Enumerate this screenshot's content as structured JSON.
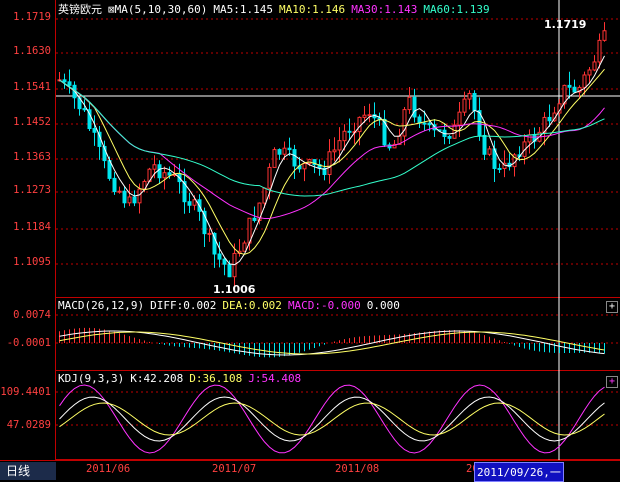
{
  "tab_label": "日线",
  "main": {
    "symbol": "英镑欧元",
    "ma_title": "MA(5,10,30,60)",
    "ma5": "MA5:1.145",
    "ma10": "MA10:1.146",
    "ma30": "MA30:1.143",
    "ma60": "MA60:1.139",
    "high_label": "1.1719",
    "low_label": "1.1006",
    "y_ticks": [
      "1.1719",
      "1.1630",
      "1.1541",
      "1.1452",
      "1.1363",
      "1.1273",
      "1.1184",
      "1.1095"
    ]
  },
  "macd": {
    "title": "MACD(26,12,9)",
    "diff": "DIFF:0.002",
    "dea": "DEA:0.002",
    "macd": "MACD:-0.000",
    "extra": "0.000",
    "y_ticks": [
      "0.0074",
      "-0.0001"
    ]
  },
  "kdj": {
    "title": "KDJ(9,3,3)",
    "k": "K:42.208",
    "d": "D:36.108",
    "j": "J:54.408",
    "y_ticks": [
      "109.4401",
      "47.0289"
    ]
  },
  "x_labels": [
    "2011/06",
    "2011/07",
    "2011/08",
    "2011/09"
  ],
  "cursor_date": "2011/09/26,一",
  "colors": {
    "up": "#ff3333",
    "down": "#00e5ee",
    "ma5": "#ffffff",
    "ma10": "#ffff66",
    "ma30": "#ff33ff",
    "ma60": "#33ffcc",
    "grid": "#c00000"
  }
}
